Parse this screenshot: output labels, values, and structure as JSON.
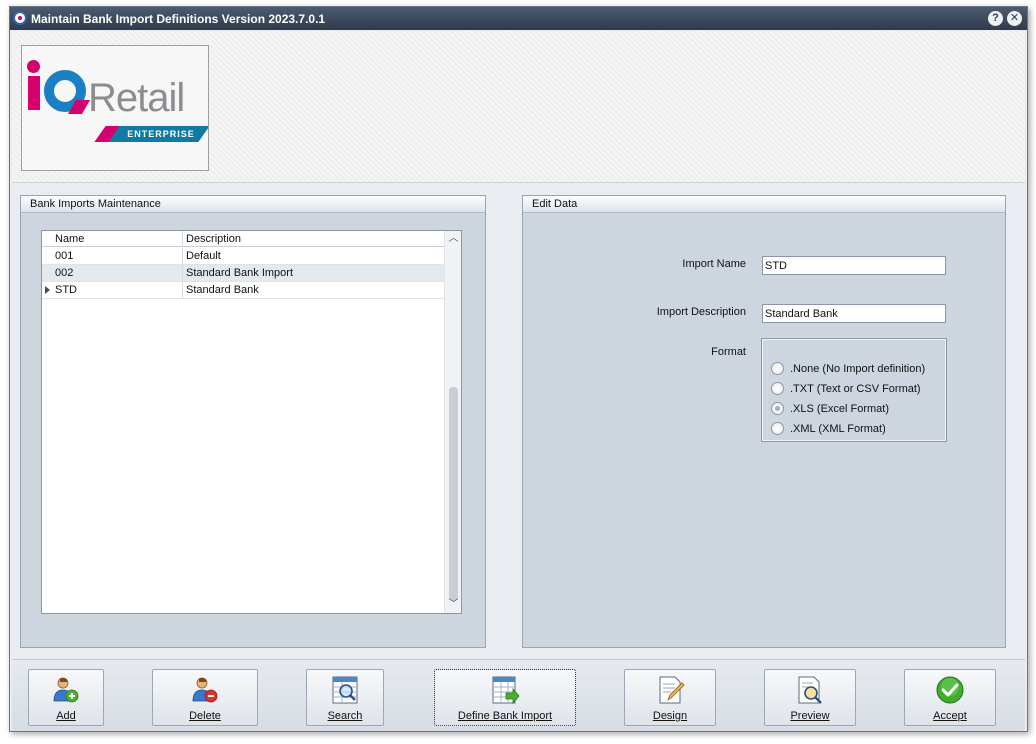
{
  "window": {
    "title": "Maintain Bank Import Definitions Version 2023.7.0.1",
    "help_glyph": "?",
    "close_glyph": "✕"
  },
  "logo": {
    "word": "Retail",
    "sub": "ENTERPRISE"
  },
  "left_panel": {
    "title": "Bank Imports Maintenance",
    "columns": [
      "Name",
      "Description"
    ],
    "rows": [
      {
        "name": "001",
        "description": "Default"
      },
      {
        "name": "002",
        "description": "Standard Bank Import"
      },
      {
        "name": "STD",
        "description": "Standard Bank"
      }
    ],
    "current_row": 2
  },
  "right_panel": {
    "title": "Edit Data",
    "import_name_label": "Import Name",
    "import_name_value": "STD",
    "import_description_label": "Import Description",
    "import_description_value": "Standard Bank",
    "format_label": "Format",
    "format_options": [
      ".None (No Import definition)",
      ".TXT (Text or CSV Format)",
      ".XLS (Excel Format)",
      ".XML (XML Format)"
    ],
    "format_selected": 2
  },
  "toolbar": {
    "add": "Add",
    "delete": "Delete",
    "search": "Search",
    "define_bank_import": "Define Bank Import",
    "design": "Design",
    "preview": "Preview",
    "accept": "Accept"
  },
  "icons": {
    "app": "iq-app-icon",
    "add": "add-user-icon",
    "delete": "delete-user-icon",
    "search": "search-grid-icon",
    "define": "define-import-icon",
    "design": "design-icon",
    "preview": "preview-icon",
    "accept": "accept-check-icon"
  },
  "colors": {
    "brand_pink": "#d6006f",
    "brand_blue": "#1b7fc4",
    "titlebar": "#3a475a",
    "panel": "#cdd5de",
    "accept_green": "#3fae2a"
  }
}
